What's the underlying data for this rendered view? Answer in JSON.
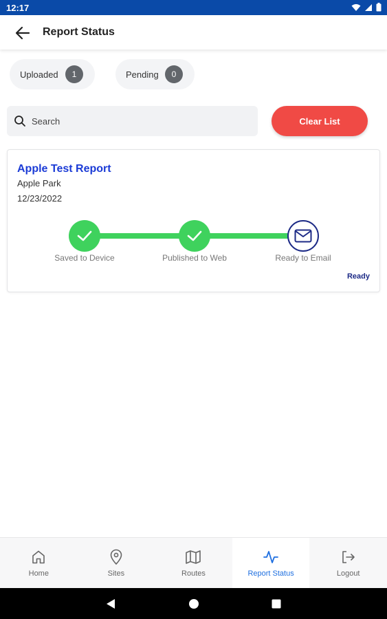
{
  "status_bar": {
    "time": "12:17"
  },
  "app_bar": {
    "title": "Report Status"
  },
  "counters": {
    "uploaded": {
      "label": "Uploaded",
      "count": "1"
    },
    "pending": {
      "label": "Pending",
      "count": "0"
    }
  },
  "search": {
    "placeholder": "Search",
    "value": ""
  },
  "actions": {
    "clear_label": "Clear List"
  },
  "report": {
    "title": "Apple Test Report",
    "site": "Apple Park",
    "date": "12/23/2022",
    "steps": [
      {
        "label": "Saved to Device",
        "state": "done",
        "icon": "check-icon"
      },
      {
        "label": "Published to Web",
        "state": "done",
        "icon": "check-icon"
      },
      {
        "label": "Ready to Email",
        "state": "pending",
        "icon": "mail-icon"
      }
    ],
    "status": "Ready"
  },
  "bottom_nav": {
    "items": [
      {
        "label": "Home",
        "icon": "home-icon",
        "active": false
      },
      {
        "label": "Sites",
        "icon": "location-pin-icon",
        "active": false
      },
      {
        "label": "Routes",
        "icon": "map-icon",
        "active": false
      },
      {
        "label": "Report Status",
        "icon": "activity-icon",
        "active": true
      },
      {
        "label": "Logout",
        "icon": "logout-icon",
        "active": false
      }
    ]
  },
  "colors": {
    "status_bar": "#0a4aa8",
    "accent_blue": "#1e6fe0",
    "report_title": "#1b3bd6",
    "success_green": "#3fd25d",
    "clear_red": "#f04a45",
    "pending_navy": "#1c2a86"
  }
}
